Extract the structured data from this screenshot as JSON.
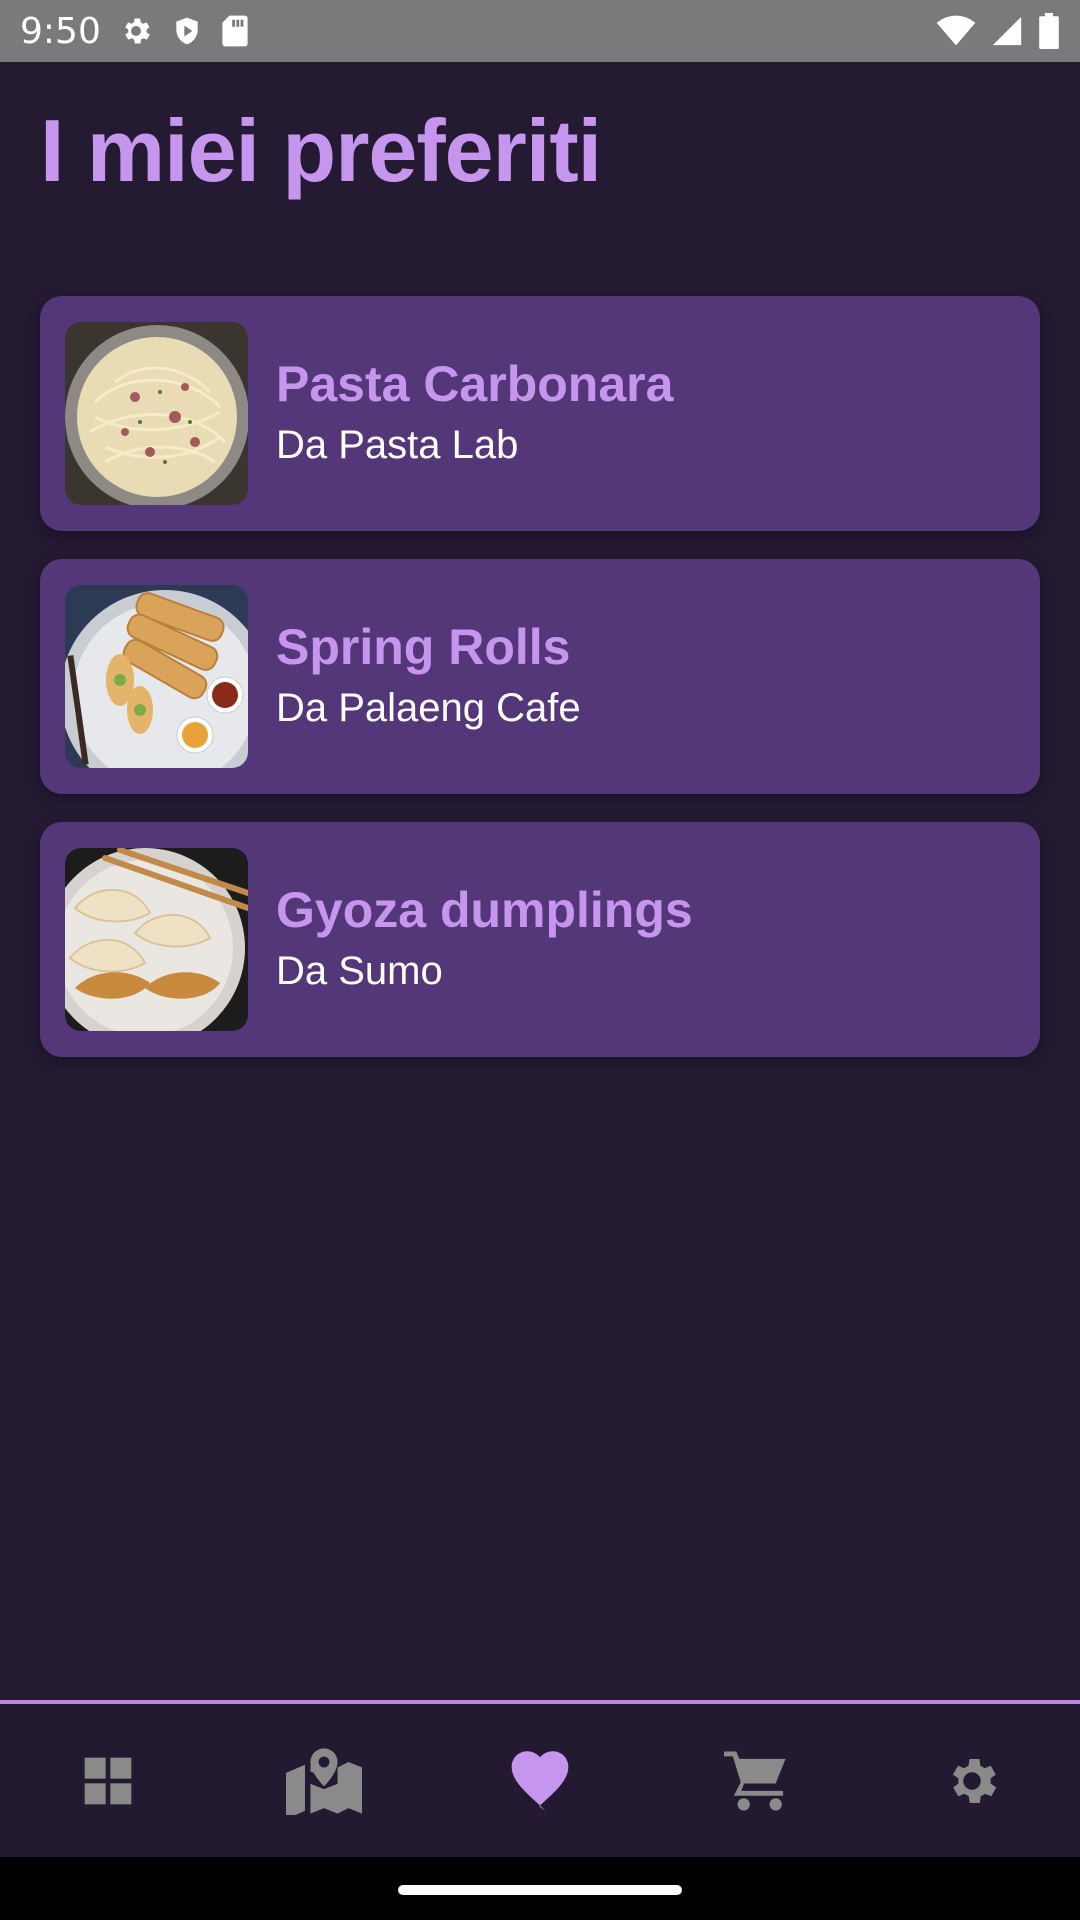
{
  "status_bar": {
    "time": "9:50",
    "left_icons": [
      "gear-icon",
      "shield-icon",
      "sd-card-icon"
    ],
    "right_icons": [
      "wifi-icon",
      "signal-icon",
      "battery-icon"
    ]
  },
  "page": {
    "title": "I miei preferiti"
  },
  "favorites": [
    {
      "name": "Pasta Carbonara",
      "place": "Da Pasta Lab",
      "image": "pasta-carbonara-photo"
    },
    {
      "name": "Spring Rolls",
      "place": "Da Palaeng Cafe",
      "image": "spring-rolls-photo"
    },
    {
      "name": "Gyoza dumplings",
      "place": "Da Sumo",
      "image": "gyoza-photo"
    }
  ],
  "bottom_nav": {
    "items": [
      {
        "icon": "dashboard-icon",
        "active": false
      },
      {
        "icon": "map-icon",
        "active": false
      },
      {
        "icon": "heart-icon",
        "active": true
      },
      {
        "icon": "cart-icon",
        "active": false
      },
      {
        "icon": "settings-icon",
        "active": false
      }
    ],
    "active_color": "#c696ee",
    "inactive_color": "#8a8a8a"
  },
  "colors": {
    "background": "#241b33",
    "card": "#543778",
    "accent": "#c696ee"
  }
}
